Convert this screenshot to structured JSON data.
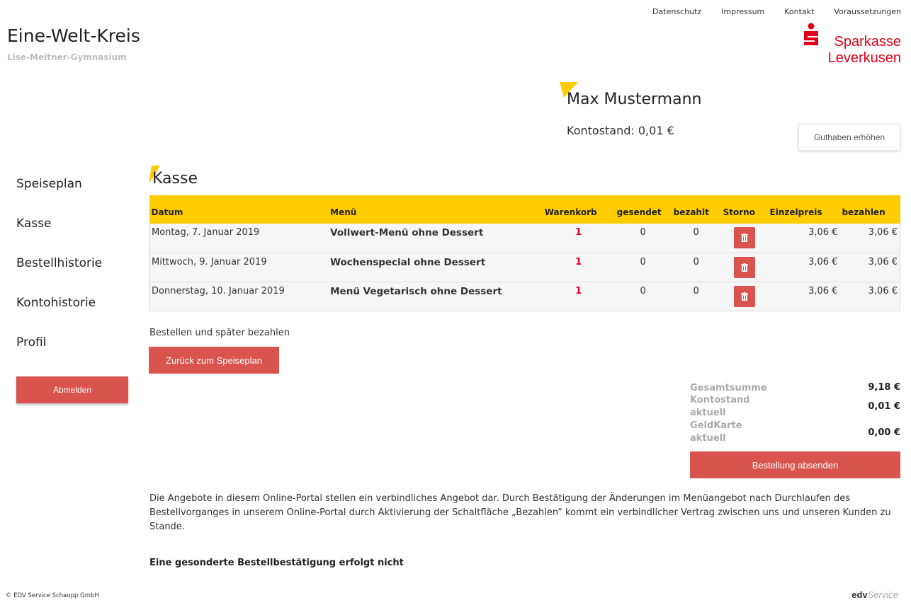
{
  "top_nav": [
    "Datenschutz",
    "Impressum",
    "Kontakt",
    "Voraussetzungen"
  ],
  "brand": {
    "title": "Eine-Welt-Kreis",
    "subtitle": "Lise-Meitner-Gymnasium"
  },
  "logo": {
    "line1": "Sparkasse",
    "line2": "Leverkusen",
    "color": "#e2001a"
  },
  "user": {
    "name": "Max Mustermann",
    "balance_label": "Kontostand: 0,01 €",
    "credit_button": "Guthaben erhöhen"
  },
  "sidebar": {
    "items": [
      "Speiseplan",
      "Kasse",
      "Bestellhistorie",
      "Kontohistorie",
      "Profil"
    ],
    "logout": "Abmelden"
  },
  "section": {
    "title": "Kasse"
  },
  "table": {
    "headers": [
      "Datum",
      "Menü",
      "Warenkorb",
      "gesendet",
      "bezahlt",
      "Storno",
      "Einzelpreis",
      "bezahlen"
    ],
    "rows": [
      {
        "date": "Montag, 7. Januar 2019",
        "menu": "Vollwert-Menü ohne Dessert",
        "cart": "1",
        "sent": "0",
        "paid": "0",
        "unit_price": "3,06 €",
        "pay": "3,06 €"
      },
      {
        "date": "Mittwoch, 9. Januar 2019",
        "menu": "Wochenspecial ohne Dessert",
        "cart": "1",
        "sent": "0",
        "paid": "0",
        "unit_price": "3,06 €",
        "pay": "3,06 €"
      },
      {
        "date": "Donnerstag, 10. Januar 2019",
        "menu": "Menü Vegetarisch ohne Dessert",
        "cart": "1",
        "sent": "0",
        "paid": "0",
        "unit_price": "3,06 €",
        "pay": "3,06 €"
      }
    ]
  },
  "actions": {
    "order_later": "Bestellen und später bezahlen",
    "back_button": "Zurück zum Speiseplan",
    "submit_button": "Bestellung absenden"
  },
  "totals": {
    "total_label": "Gesamtsumme",
    "total_value": "9,18 €",
    "balance_label": "Kontostand aktuell",
    "balance_value": "0,01 €",
    "geldkarte_label": "GeldKarte aktuell",
    "geldkarte_value": "0,00 €"
  },
  "disclaimer": "Die Angebote in diesem Online-Portal stellen ein verbindliches Angebot dar. Durch Bestätigung der Änderungen im Menüangebot nach Durchlaufen des Bestellvorganges in unserem Online-Portal durch Aktivierung der Schaltfläche „Bezahlen“ kommt ein verbindlicher Vertrag zwischen uns und unseren Kunden zu Stande.",
  "no_confirmation": "Eine gesonderte Bestellbestätigung erfolgt nicht",
  "footer": {
    "copyright": "© EDV Service Schaupp GmbH",
    "brand_edv": "edv",
    "brand_service": "Service"
  },
  "colors": {
    "accent_yellow": "#ffcc00",
    "button_red": "#d9534f",
    "brand_red": "#e2001a"
  }
}
